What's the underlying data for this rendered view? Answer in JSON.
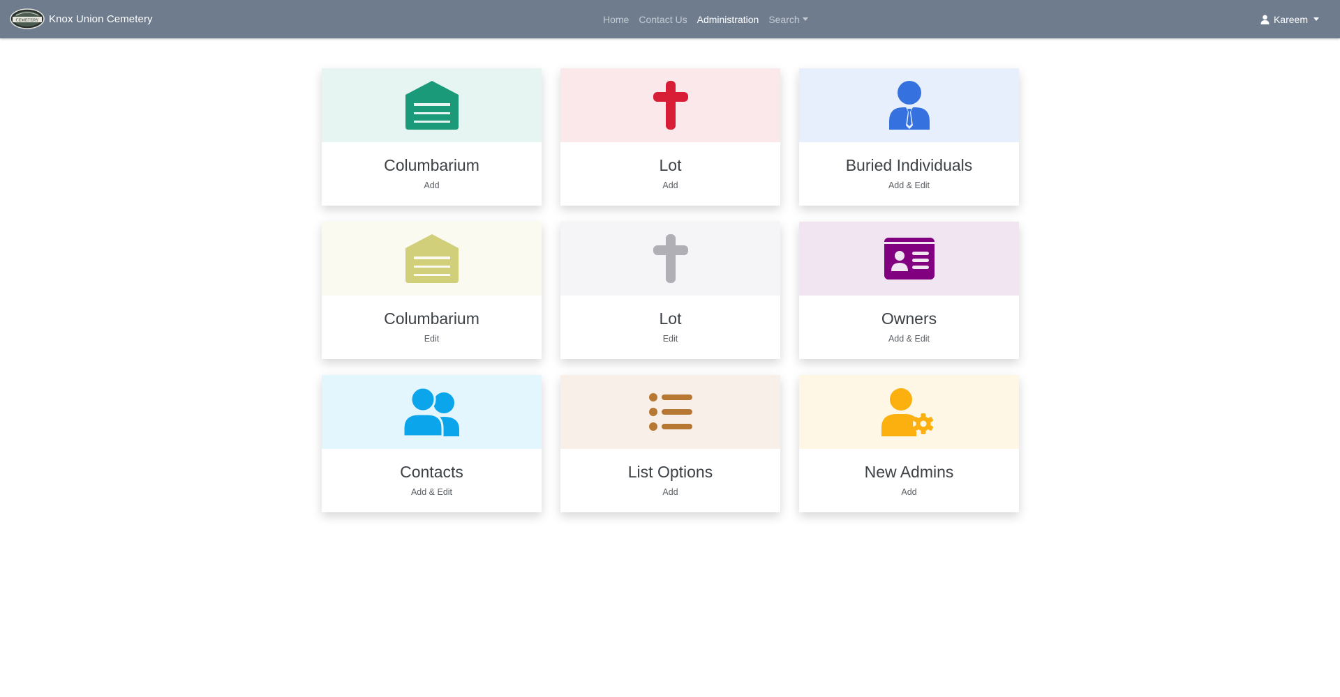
{
  "navbar": {
    "brand": "Knox Union Cemetery",
    "logo_text": "CEMETERY",
    "links": [
      {
        "label": "Home"
      },
      {
        "label": "Contact Us"
      },
      {
        "label": "Administration"
      },
      {
        "label": "Search"
      }
    ],
    "user": "Kareem",
    "bg_color": "#6e7c8e"
  },
  "cards": [
    {
      "title": "Columbarium",
      "subtitle": "Add",
      "icon": "columbarium-icon",
      "icon_color": "#1a9a79",
      "bg": "#e6f5f1"
    },
    {
      "title": "Lot",
      "subtitle": "Add",
      "icon": "cross-icon",
      "icon_color": "#d81e36",
      "bg": "#fbe8eb"
    },
    {
      "title": "Buried Individuals",
      "subtitle": "Add & Edit",
      "icon": "person-tie-icon",
      "icon_color": "#3572e0",
      "bg": "#e8effc"
    },
    {
      "title": "Columbarium",
      "subtitle": "Edit",
      "icon": "columbarium-icon",
      "icon_color": "#d1cf7a",
      "bg": "#fafaf1"
    },
    {
      "title": "Lot",
      "subtitle": "Edit",
      "icon": "cross-icon",
      "icon_color": "#b0afb6",
      "bg": "#f5f5f7"
    },
    {
      "title": "Owners",
      "subtitle": "Add & Edit",
      "icon": "id-card-icon",
      "icon_color": "#800080",
      "bg": "#f1e5f2"
    },
    {
      "title": "Contacts",
      "subtitle": "Add & Edit",
      "icon": "users-icon",
      "icon_color": "#0aa5ea",
      "bg": "#e3f6fd"
    },
    {
      "title": "List Options",
      "subtitle": "Add",
      "icon": "list-icon",
      "icon_color": "#b77833",
      "bg": "#f8efe8"
    },
    {
      "title": "New Admins",
      "subtitle": "Add",
      "icon": "user-gear-icon",
      "icon_color": "#fbb010",
      "bg": "#fef7e6"
    }
  ]
}
